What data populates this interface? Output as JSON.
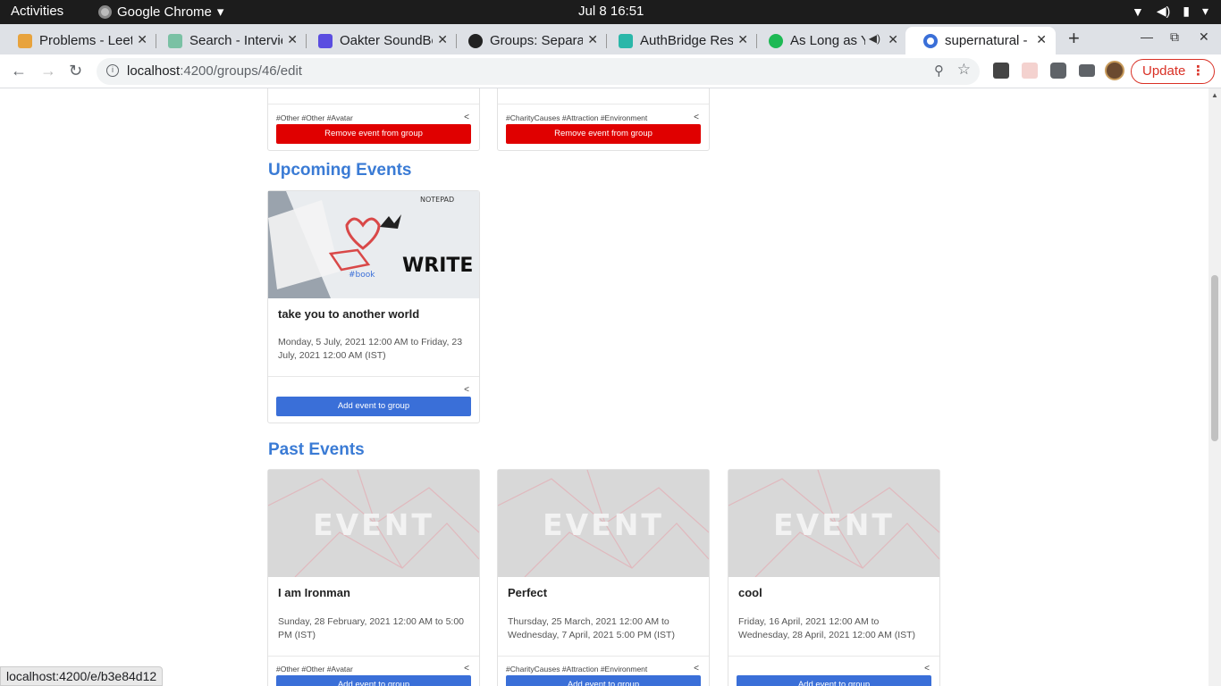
{
  "system": {
    "activities": "Activities",
    "app_name": "Google Chrome",
    "clock": "Jul 8  16:51"
  },
  "tabs": [
    {
      "title": "Problems - LeetCode",
      "icon_color": "#e8a33d",
      "active": false
    },
    {
      "title": "Search - Interview",
      "icon_color": "#7ac1a4",
      "active": false
    },
    {
      "title": "Oakter SoundBox",
      "icon_color": "#5a4de0",
      "active": false
    },
    {
      "title": "Groups: Separate",
      "icon_color": "#222222",
      "active": false
    },
    {
      "title": "AuthBridge Research",
      "icon_color": "#2ab7a9",
      "active": false
    },
    {
      "title": "As Long as You Love Me",
      "icon_color": "#1db954",
      "active": false
    },
    {
      "title": "supernatural - Dashboard",
      "icon_color": "#3a6fd8",
      "active": true
    }
  ],
  "address_bar": {
    "host": "localhost",
    "path": ":4200/groups/46/edit",
    "update_label": "Update"
  },
  "group_events": [
    {
      "tags": "#Other #Other #Avatar",
      "button": "Remove event from group"
    },
    {
      "tags": "#CharityCauses #Attraction #Environment",
      "button": "Remove event from group"
    }
  ],
  "sections": {
    "upcoming": "Upcoming Events",
    "past": "Past Events"
  },
  "upcoming_events": [
    {
      "title": "take you to another world",
      "date": "Monday, 5 July, 2021 12:00 AM to Friday, 23 July, 2021 12:00 AM (IST)",
      "button": "Add event to group",
      "image_text": "WRITE YOUR",
      "image_caption": "NOTEPAD",
      "sticker_text": "#book"
    }
  ],
  "past_events": [
    {
      "title": "I am Ironman",
      "date": "Sunday, 28 February, 2021 12:00 AM to 5:00 PM (IST)",
      "tags": "#Other #Other #Avatar",
      "button": "Add event to group",
      "placeholder": "EVENT"
    },
    {
      "title": "Perfect",
      "date": "Thursday, 25 March, 2021 12:00 AM to Wednesday, 7 April, 2021 5:00 PM (IST)",
      "tags": "#CharityCauses #Attraction #Environment",
      "button": "Add event to group",
      "placeholder": "EVENT"
    },
    {
      "title": "cool",
      "date": "Friday, 16 April, 2021 12:00 AM to Wednesday, 28 April, 2021 12:00 AM (IST)",
      "tags": "",
      "button": "Add event to group",
      "placeholder": "EVENT"
    }
  ],
  "status_url": "localhost:4200/e/b3e84d12"
}
